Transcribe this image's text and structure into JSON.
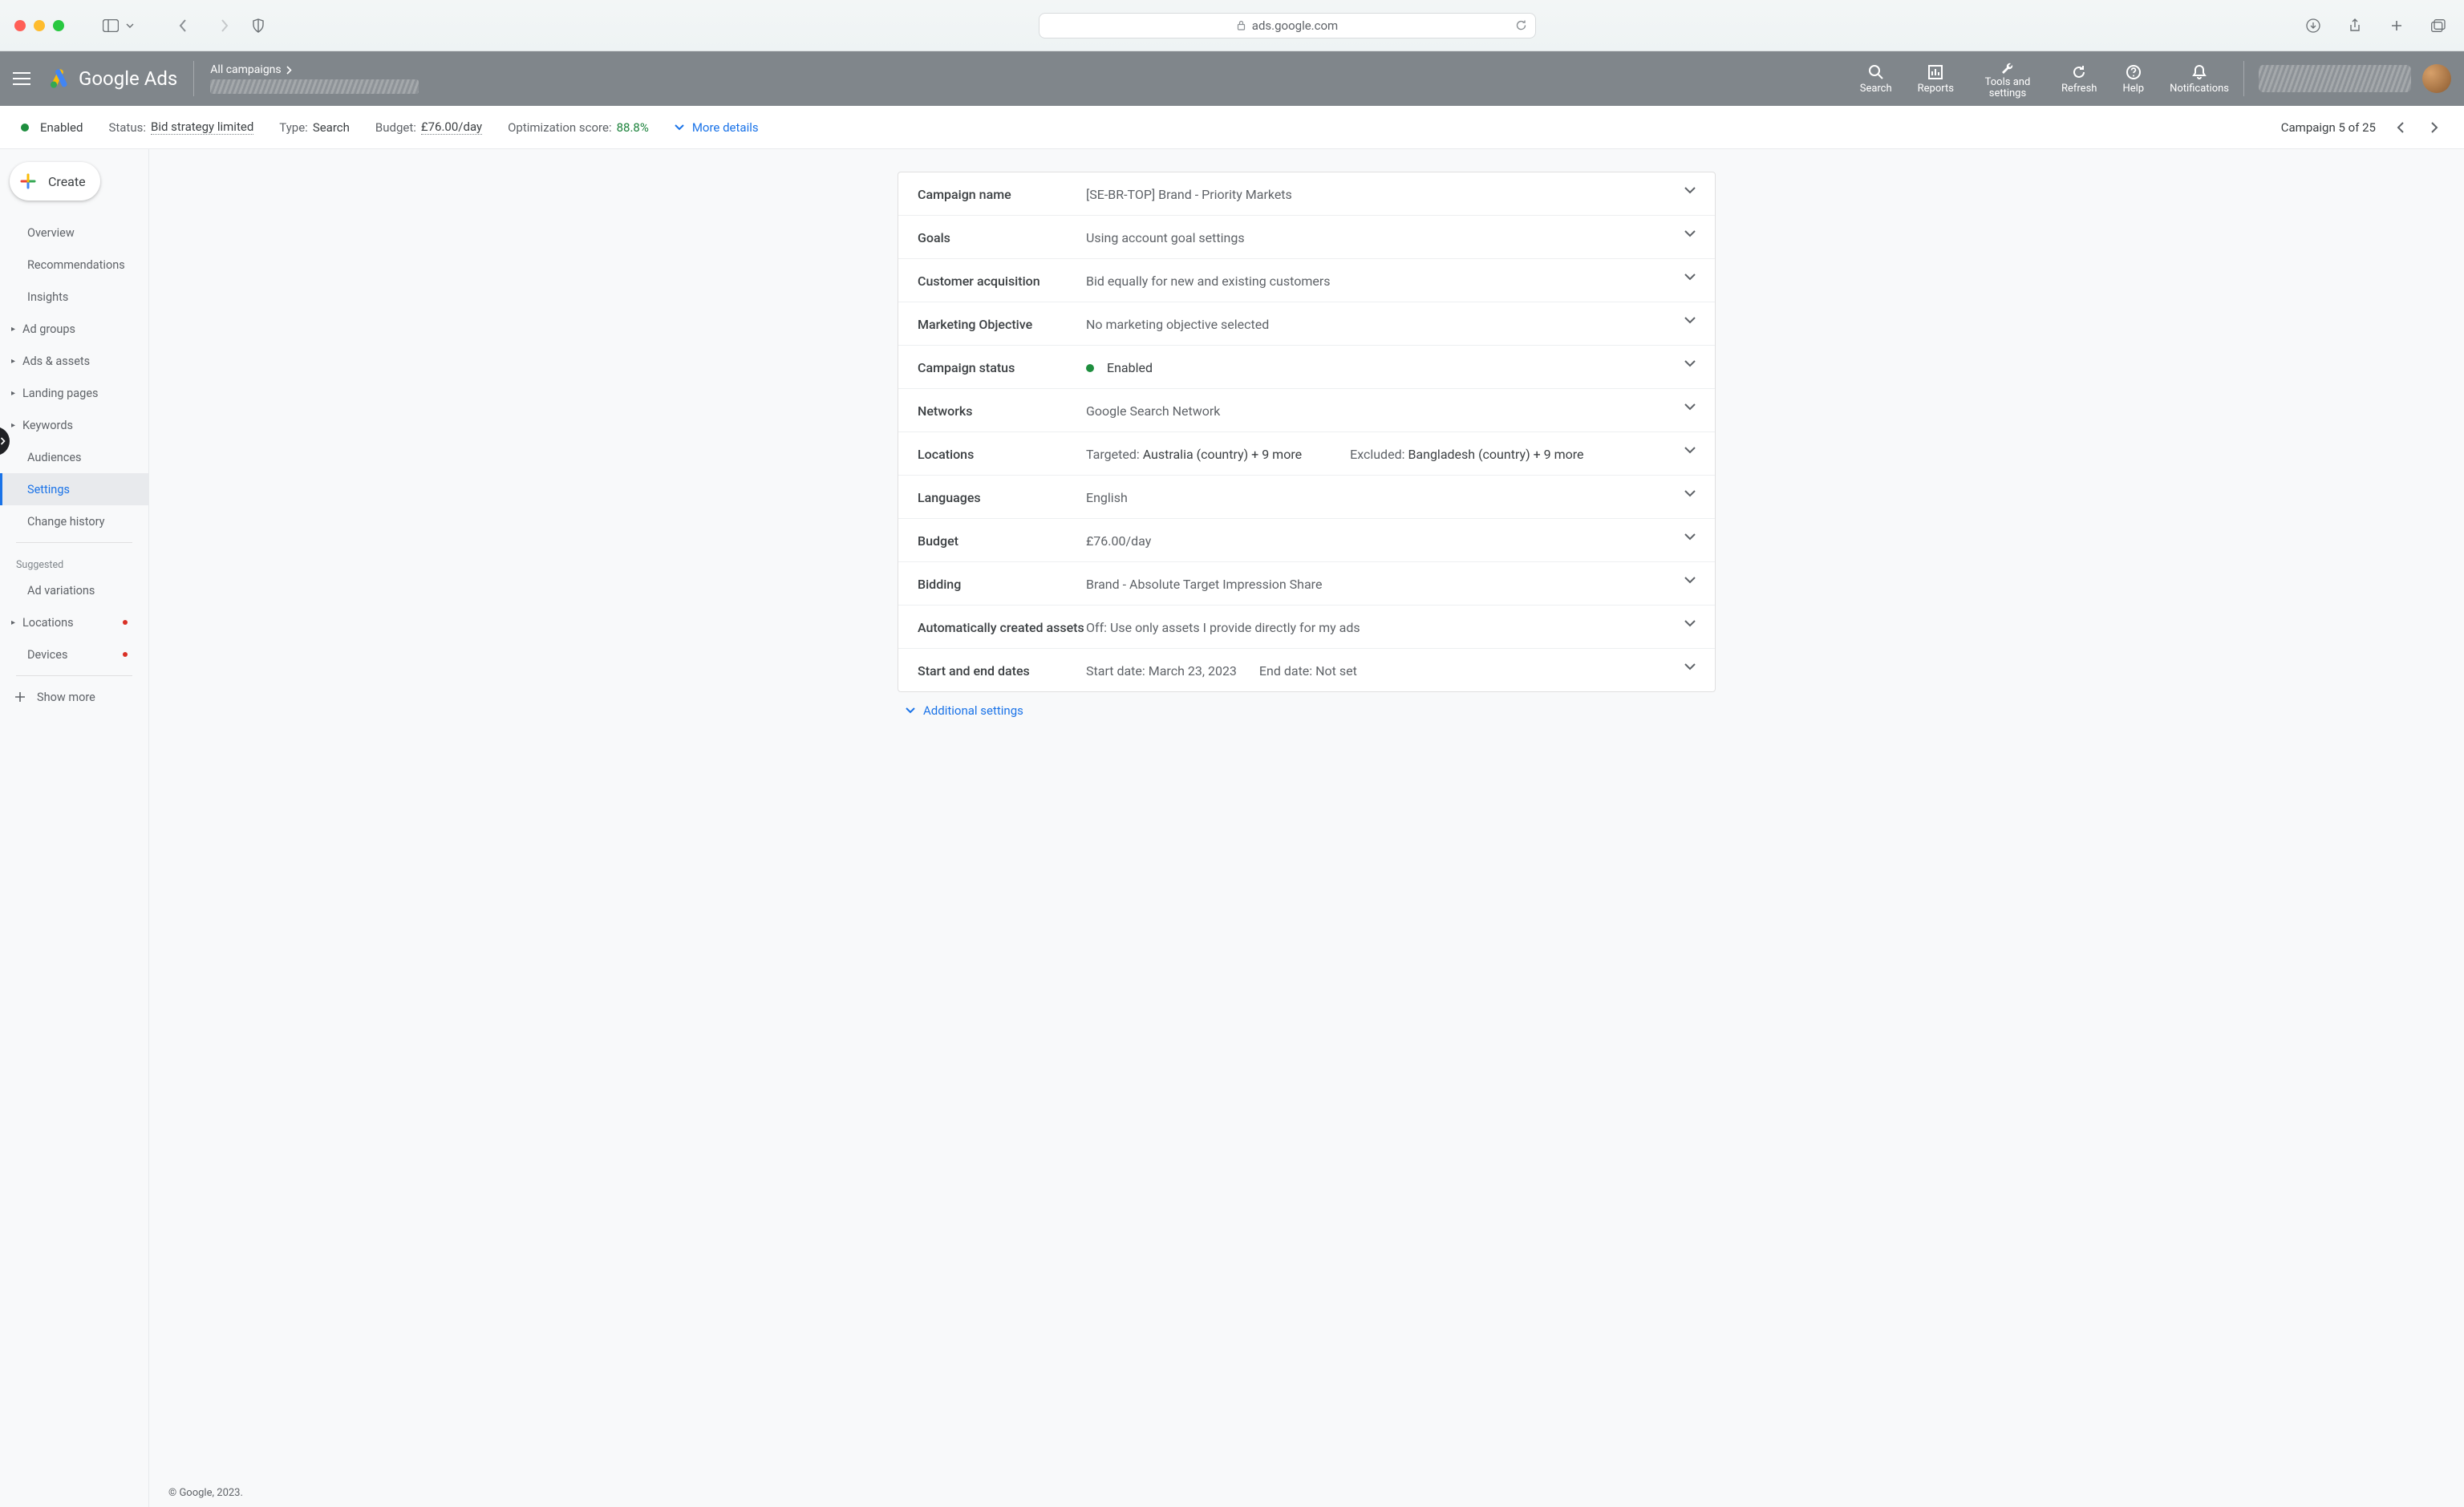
{
  "browser": {
    "url": "ads.google.com"
  },
  "header": {
    "brand": "Google Ads",
    "breadcrumb": "All campaigns",
    "tools": [
      {
        "label": "Search"
      },
      {
        "label": "Reports"
      },
      {
        "label": "Tools and settings"
      },
      {
        "label": "Refresh"
      },
      {
        "label": "Help"
      },
      {
        "label": "Notifications"
      }
    ]
  },
  "statusbar": {
    "enabled_label": "Enabled",
    "status_label": "Status:",
    "status_value": "Bid strategy limited",
    "type_label": "Type:",
    "type_value": "Search",
    "budget_label": "Budget:",
    "budget_value": "£76.00/day",
    "opt_label": "Optimization score:",
    "opt_value": "88.8%",
    "more_details": "More details",
    "pager_text": "Campaign 5 of 25"
  },
  "sidebar": {
    "create": "Create",
    "items": [
      {
        "label": "Overview"
      },
      {
        "label": "Recommendations"
      },
      {
        "label": "Insights"
      },
      {
        "label": "Ad groups"
      },
      {
        "label": "Ads & assets"
      },
      {
        "label": "Landing pages"
      },
      {
        "label": "Keywords"
      },
      {
        "label": "Audiences"
      },
      {
        "label": "Settings"
      },
      {
        "label": "Change history"
      }
    ],
    "suggested_label": "Suggested",
    "suggested": [
      {
        "label": "Ad variations"
      },
      {
        "label": "Locations"
      },
      {
        "label": "Devices"
      }
    ],
    "show_more": "Show more"
  },
  "settings": {
    "rows": {
      "campaign_name": {
        "label": "Campaign name",
        "value": "[SE-BR-TOP] Brand - Priority Markets"
      },
      "goals": {
        "label": "Goals",
        "value": "Using account goal settings"
      },
      "customer_acq": {
        "label": "Customer acquisition",
        "value": "Bid equally for new and existing customers"
      },
      "marketing_obj": {
        "label": "Marketing Objective",
        "value": "No marketing objective selected"
      },
      "campaign_status": {
        "label": "Campaign status",
        "value": "Enabled"
      },
      "networks": {
        "label": "Networks",
        "value": "Google Search Network"
      },
      "locations": {
        "label": "Locations",
        "targeted_label": "Targeted: ",
        "targeted_value": "Australia (country) + 9 more",
        "excluded_label": "Excluded: ",
        "excluded_value": "Bangladesh (country) + 9 more"
      },
      "languages": {
        "label": "Languages",
        "value": "English"
      },
      "budget": {
        "label": "Budget",
        "value": "£76.00/day"
      },
      "bidding": {
        "label": "Bidding",
        "value": "Brand - Absolute Target Impression Share"
      },
      "auto_assets": {
        "label": "Automatically created assets",
        "value": "Off: Use only assets I provide directly for my ads"
      },
      "dates": {
        "label": "Start and end dates",
        "start_label": "Start date: ",
        "start_value": "March 23, 2023",
        "end_label": "End date: ",
        "end_value": "Not set"
      }
    },
    "additional": "Additional settings"
  },
  "footer": "© Google, 2023."
}
